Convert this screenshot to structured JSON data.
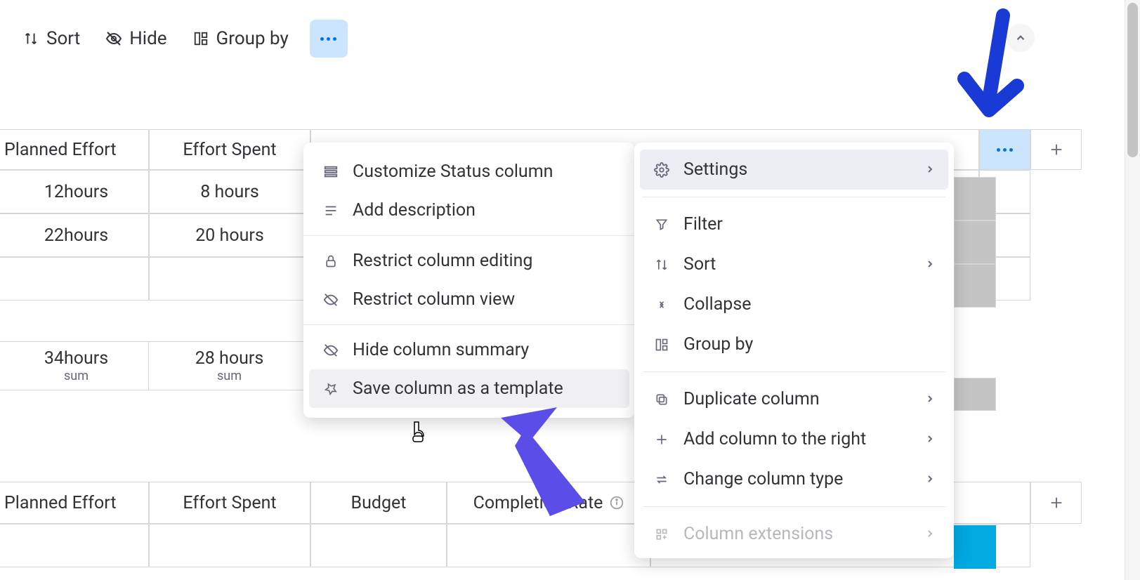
{
  "toolbar": {
    "sort": "Sort",
    "hide": "Hide",
    "groupby": "Group by"
  },
  "table1": {
    "headers": {
      "planned": "Planned Effort",
      "effort": "Effort Spent"
    },
    "rows": [
      {
        "planned": "12hours",
        "effort": "8 hours"
      },
      {
        "planned": "22hours",
        "effort": "20 hours"
      }
    ],
    "summary": {
      "planned_val": "34hours",
      "effort_val": "28 hours",
      "sub": "sum"
    }
  },
  "table2": {
    "headers": {
      "planned": "Planned Effort",
      "effort": "Effort Spent",
      "budget": "Budget",
      "completion": "Completion Rate"
    }
  },
  "menu_left": {
    "customize": "Customize Status column",
    "add_desc": "Add description",
    "restrict_edit": "Restrict column editing",
    "restrict_view": "Restrict column view",
    "hide_summary": "Hide column summary",
    "save_template": "Save column as a template"
  },
  "menu_right": {
    "settings": "Settings",
    "filter": "Filter",
    "sort": "Sort",
    "collapse": "Collapse",
    "groupby": "Group by",
    "duplicate": "Duplicate column",
    "add_right": "Add column to the right",
    "change_type": "Change column type",
    "extensions": "Column extensions"
  }
}
